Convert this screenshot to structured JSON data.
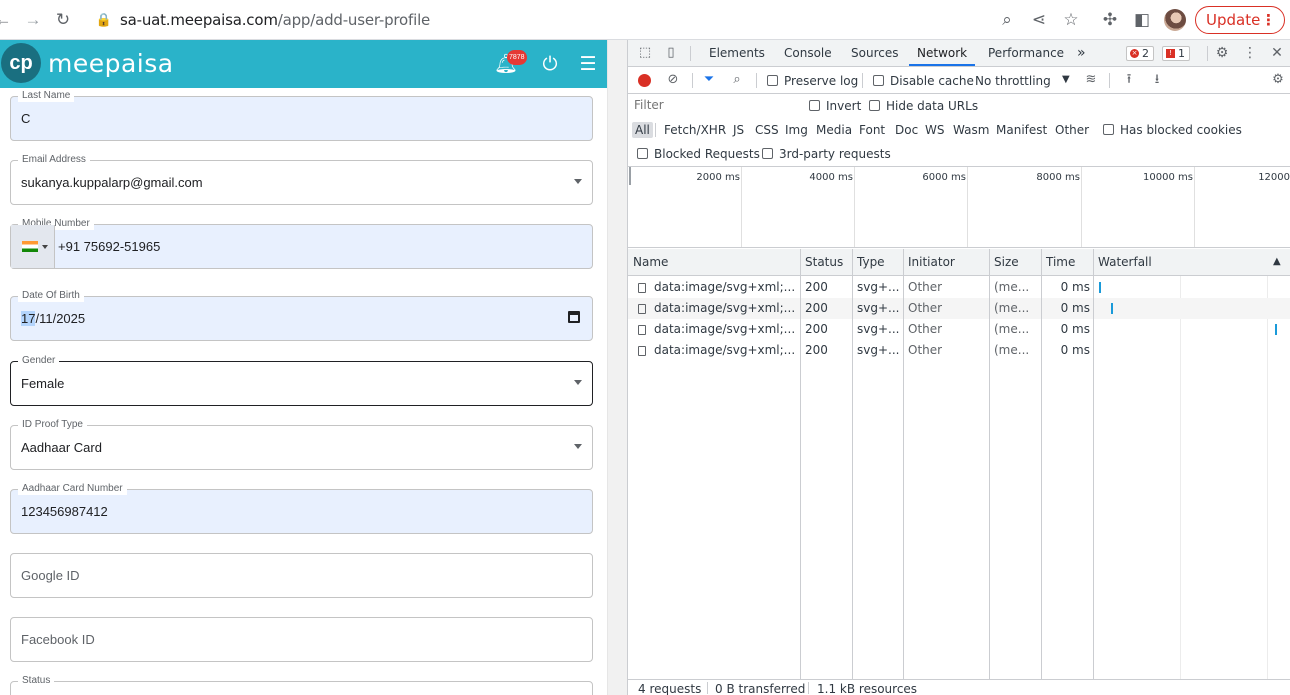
{
  "browser": {
    "url_host": "sa-uat.meepaisa.com",
    "url_path": "/app/add-user-profile",
    "update_label": "Update"
  },
  "app": {
    "logo_mark": "cp",
    "logo_text": "meepaisa",
    "notification_count": "7878",
    "fields": {
      "last_name": {
        "label": "Last Name",
        "value": "C"
      },
      "email": {
        "label": "Email Address",
        "value": "sukanya.kuppalarp@gmail.com"
      },
      "mobile": {
        "label": "Mobile Number",
        "value": "+91 75692-51965"
      },
      "dob": {
        "label": "Date Of Birth",
        "value_day": "17",
        "value_rest": "/11/2025"
      },
      "gender": {
        "label": "Gender",
        "value": "Female"
      },
      "id_proof": {
        "label": "ID Proof Type",
        "value": "Aadhaar Card"
      },
      "aadhaar": {
        "label": "Aadhaar Card Number",
        "value": "123456987412"
      },
      "google": {
        "placeholder": "Google ID"
      },
      "facebook": {
        "placeholder": "Facebook ID"
      },
      "status": {
        "label": "Status"
      }
    }
  },
  "devtools": {
    "tabs": [
      "Elements",
      "Console",
      "Sources",
      "Network",
      "Performance"
    ],
    "active_tab": "Network",
    "more_tabs": "»",
    "error_count": "2",
    "issue_count": "1",
    "toolbar": {
      "preserve_log": "Preserve log",
      "disable_cache": "Disable cache",
      "throttling": "No throttling"
    },
    "filter": {
      "placeholder": "Filter",
      "invert": "Invert",
      "hide_data_urls": "Hide data URLs"
    },
    "types": [
      "All",
      "Fetch/XHR",
      "JS",
      "CSS",
      "Img",
      "Media",
      "Font",
      "Doc",
      "WS",
      "Wasm",
      "Manifest",
      "Other"
    ],
    "has_blocked_cookies": "Has blocked cookies",
    "blocked_requests": "Blocked Requests",
    "third_party": "3rd-party requests",
    "timeline_ticks": [
      "2000 ms",
      "4000 ms",
      "6000 ms",
      "8000 ms",
      "10000 ms",
      "12000"
    ],
    "columns": [
      "Name",
      "Status",
      "Type",
      "Initiator",
      "Size",
      "Time",
      "Waterfall"
    ],
    "rows": [
      {
        "name": "data:image/svg+xml;...",
        "status": "200",
        "type": "svg+...",
        "initiator": "Other",
        "size": "(me...",
        "time": "0 ms"
      },
      {
        "name": "data:image/svg+xml;...",
        "status": "200",
        "type": "svg+...",
        "initiator": "Other",
        "size": "(me...",
        "time": "0 ms"
      },
      {
        "name": "data:image/svg+xml;...",
        "status": "200",
        "type": "svg+...",
        "initiator": "Other",
        "size": "(me...",
        "time": "0 ms"
      },
      {
        "name": "data:image/svg+xml;...",
        "status": "200",
        "type": "svg+...",
        "initiator": "Other",
        "size": "(me...",
        "time": "0 ms"
      }
    ],
    "summary": {
      "requests": "4 requests",
      "transferred": "0 B transferred",
      "resources": "1.1 kB resources"
    },
    "colors": {
      "accent": "#1a73e8",
      "record": "#d93025",
      "waterfall": "#1a9ad9"
    }
  }
}
